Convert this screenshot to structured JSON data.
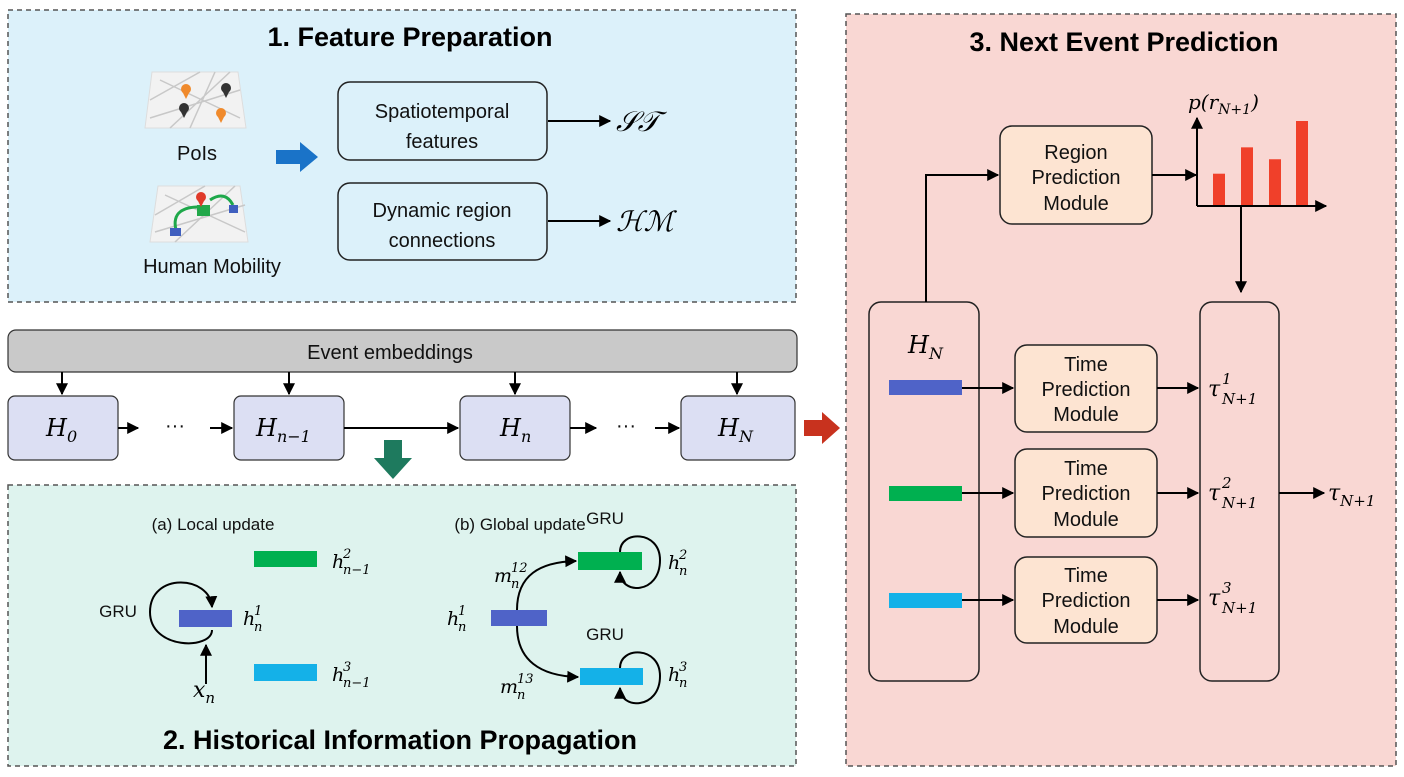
{
  "colors": {
    "feature_panel_bg": "#dcf1fa",
    "propagation_panel_bg": "#def3ee",
    "prediction_panel_bg": "#f9d7d3",
    "hidden_box_fill": "#dcdff3",
    "module_fill": "#fde4d2",
    "embedding_bar": "#c9c9c9",
    "region1": "#4f63c8",
    "region2": "#00b050",
    "region3": "#14b1e8",
    "probability_bars": "#f0402a",
    "blue_arrow": "#1a73c8",
    "green_arrow": "#1e7a5e",
    "red_arrow": "#c8321e"
  },
  "feature_preparation": {
    "title": "1. Feature Preparation",
    "pois_label": "PoIs",
    "mobility_label": "Human Mobility",
    "box_spatiotemporal": [
      "Spatiotemporal",
      "features"
    ],
    "box_dynamic": [
      "Dynamic region",
      "connections"
    ],
    "output_st": "𝒮𝒯",
    "output_hm": "ℋℳ"
  },
  "event_sequence": {
    "embeddings_label": "Event embeddings",
    "ellipsis": "···",
    "states": [
      {
        "base": "H",
        "sub": "0"
      },
      {
        "base": "H",
        "sub": "n−1"
      },
      {
        "base": "H",
        "sub": "n"
      },
      {
        "base": "H",
        "sub": "N"
      }
    ]
  },
  "propagation": {
    "title": "2. Historical Information Propagation",
    "local_title": "(a) Local update",
    "global_title": "(b) Global update",
    "gru": "GRU",
    "local": {
      "h2": {
        "base": "h",
        "sup": "2",
        "sub": "n−1"
      },
      "h1": {
        "base": "h",
        "sup": "1",
        "sub": "n"
      },
      "h3": {
        "base": "h",
        "sup": "3",
        "sub": "n−1"
      },
      "x": {
        "base": "x",
        "sub": "n"
      }
    },
    "global": {
      "h1": {
        "base": "h",
        "sup": "1",
        "sub": "n"
      },
      "h2": {
        "base": "h",
        "sup": "2",
        "sub": "n"
      },
      "h3": {
        "base": "h",
        "sup": "3",
        "sub": "n"
      },
      "m12": {
        "base": "m",
        "sup": "12",
        "sub": "n"
      },
      "m13": {
        "base": "m",
        "sup": "13",
        "sub": "n"
      }
    }
  },
  "prediction": {
    "title": "3. Next Event Prediction",
    "hidden": {
      "base": "H",
      "sub": "N"
    },
    "region_module": [
      "Region",
      "Prediction",
      "Module"
    ],
    "time_module": [
      "Time",
      "Prediction",
      "Module"
    ],
    "prob_label": {
      "pre": "p(",
      "base": "r",
      "sub": "N+1",
      "post": ")"
    },
    "prob_bars": [
      0.38,
      0.69,
      0.55,
      1.0
    ],
    "taus": [
      {
        "base": "τ",
        "sup": "1",
        "sub": "N+1"
      },
      {
        "base": "τ",
        "sup": "2",
        "sub": "N+1"
      },
      {
        "base": "τ",
        "sup": "3",
        "sub": "N+1"
      }
    ],
    "output": {
      "base": "τ",
      "sub": "N+1"
    }
  }
}
